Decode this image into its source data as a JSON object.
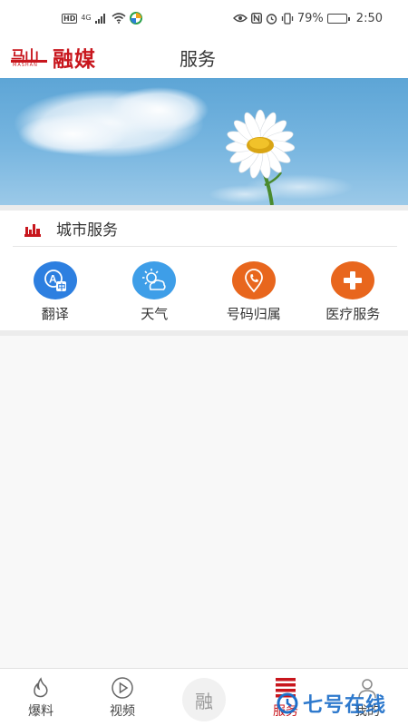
{
  "status_bar": {
    "left_badge": "HD",
    "network": "4G",
    "battery": "79%",
    "battery_level": 0.79,
    "time": "2:50"
  },
  "header": {
    "logo": {
      "main": "马山",
      "brand": "融媒",
      "sub": "MASHAN"
    },
    "title": "服务"
  },
  "banner": {
    "image": "daisy-against-blue-sky"
  },
  "city_services": {
    "title": "城市服务",
    "icon": "city-skyline-icon",
    "items": [
      {
        "label": "翻译",
        "icon": "translate-icon",
        "color": "#2d7fe0"
      },
      {
        "label": "天气",
        "icon": "weather-icon",
        "color": "#3e9ee8"
      },
      {
        "label": "号码归属",
        "icon": "phone-location-icon",
        "color": "#e8661d"
      },
      {
        "label": "医疗服务",
        "icon": "medical-plus-icon",
        "color": "#e8661d"
      }
    ]
  },
  "bottom_nav": {
    "items": [
      {
        "label": "爆料",
        "icon": "fire-icon",
        "active": false
      },
      {
        "label": "视频",
        "icon": "play-icon",
        "active": false
      },
      {
        "label": "",
        "icon": "rong-center-icon",
        "glyph": "融",
        "active": false
      },
      {
        "label": "服务",
        "icon": "service-list-icon",
        "active": true
      },
      {
        "label": "我的",
        "icon": "user-icon",
        "active": false
      }
    ]
  },
  "colors": {
    "brand_red": "#c8161d",
    "blue": "#2d7fe0",
    "orange": "#e8661d"
  },
  "watermark": {
    "text": "七号在线"
  }
}
